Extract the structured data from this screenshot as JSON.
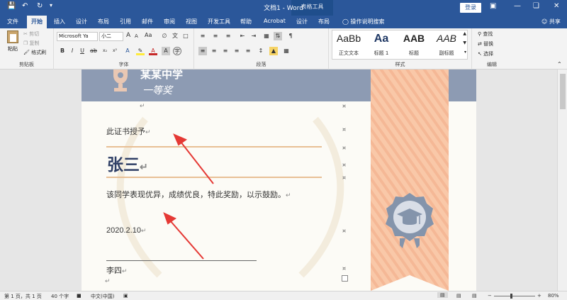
{
  "titlebar": {
    "title": "文档1 - Word",
    "context_label": "表格工具",
    "login_label": "登录",
    "save_icon": "save-icon",
    "undo_icon": "undo-icon",
    "redo_icon": "redo-icon",
    "customize_icon": "customize-icon"
  },
  "tabs": [
    "文件",
    "开始",
    "插入",
    "设计",
    "布局",
    "引用",
    "邮件",
    "审阅",
    "视图",
    "开发工具",
    "帮助",
    "Acrobat",
    "设计",
    "布局"
  ],
  "tellme": "操作说明搜索",
  "share": "共享",
  "ribbon": {
    "clipboard": {
      "paste": "粘贴",
      "cut": "剪切",
      "copy": "复制",
      "format_painter": "格式刷",
      "label": "剪贴板"
    },
    "font": {
      "name": "Microsoft Ya",
      "size": "小二",
      "grow": "A",
      "shrink": "A",
      "case": "Aa",
      "label": "字体"
    },
    "paragraph": {
      "label": "段落"
    },
    "styles": {
      "label": "样式",
      "items": [
        {
          "sample": "AaBb",
          "name": "正文文本"
        },
        {
          "sample": "Aa",
          "name": "标题 1"
        },
        {
          "sample": "AAB",
          "name": "标题"
        },
        {
          "sample": "AAB",
          "name": "副标题"
        }
      ]
    },
    "editing": {
      "find": "查找",
      "replace": "替换",
      "select": "选择",
      "label": "编辑"
    }
  },
  "document": {
    "school": "某某中学",
    "award": "一等奖",
    "line1": "此证书授予",
    "name": "张三",
    "commendation": "该同学表现优异，成绩优良，特此奖励，以示鼓励。",
    "date": "2020.2.10",
    "signer": "李四",
    "para_mark": "↵",
    "cell_mark": "¤"
  },
  "status": {
    "page": "第 1 页，共 1 页",
    "words": "40 个字",
    "language": "中文(中国)",
    "zoom": "80%"
  },
  "colors": {
    "word_blue": "#2b579a",
    "header_band": "#8d9bb3",
    "ribbon_strip": "#f9c8a8",
    "badge": "#8494ab",
    "arrow": "#e53935",
    "rule": "#e8bf95"
  }
}
